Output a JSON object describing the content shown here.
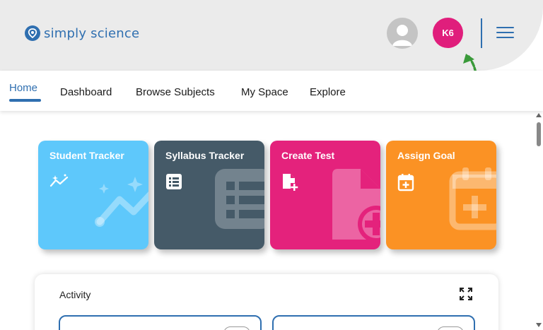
{
  "header": {
    "logo_text": "simply science",
    "avatar_initials": "K6",
    "colors": {
      "brand": "#2f6fb0",
      "accent": "#e01e7c",
      "arrow": "#3a9a3a"
    }
  },
  "nav": {
    "items": [
      {
        "label": "Home",
        "active": true
      },
      {
        "label": "Dashboard"
      },
      {
        "label": "Browse Subjects"
      },
      {
        "label": "My Space"
      },
      {
        "label": "Explore"
      }
    ]
  },
  "cards": [
    {
      "title": "Student Tracker",
      "icon": "trend-icon",
      "color": "#5ec8fb"
    },
    {
      "title": "Syllabus Tracker",
      "icon": "list-icon",
      "color": "#455a68"
    },
    {
      "title": "Create Test",
      "icon": "file-plus-icon",
      "color": "#e4227c"
    },
    {
      "title": "Assign Goal",
      "icon": "calendar-plus-icon",
      "color": "#fb9224"
    }
  ],
  "activity": {
    "title": "Activity"
  }
}
